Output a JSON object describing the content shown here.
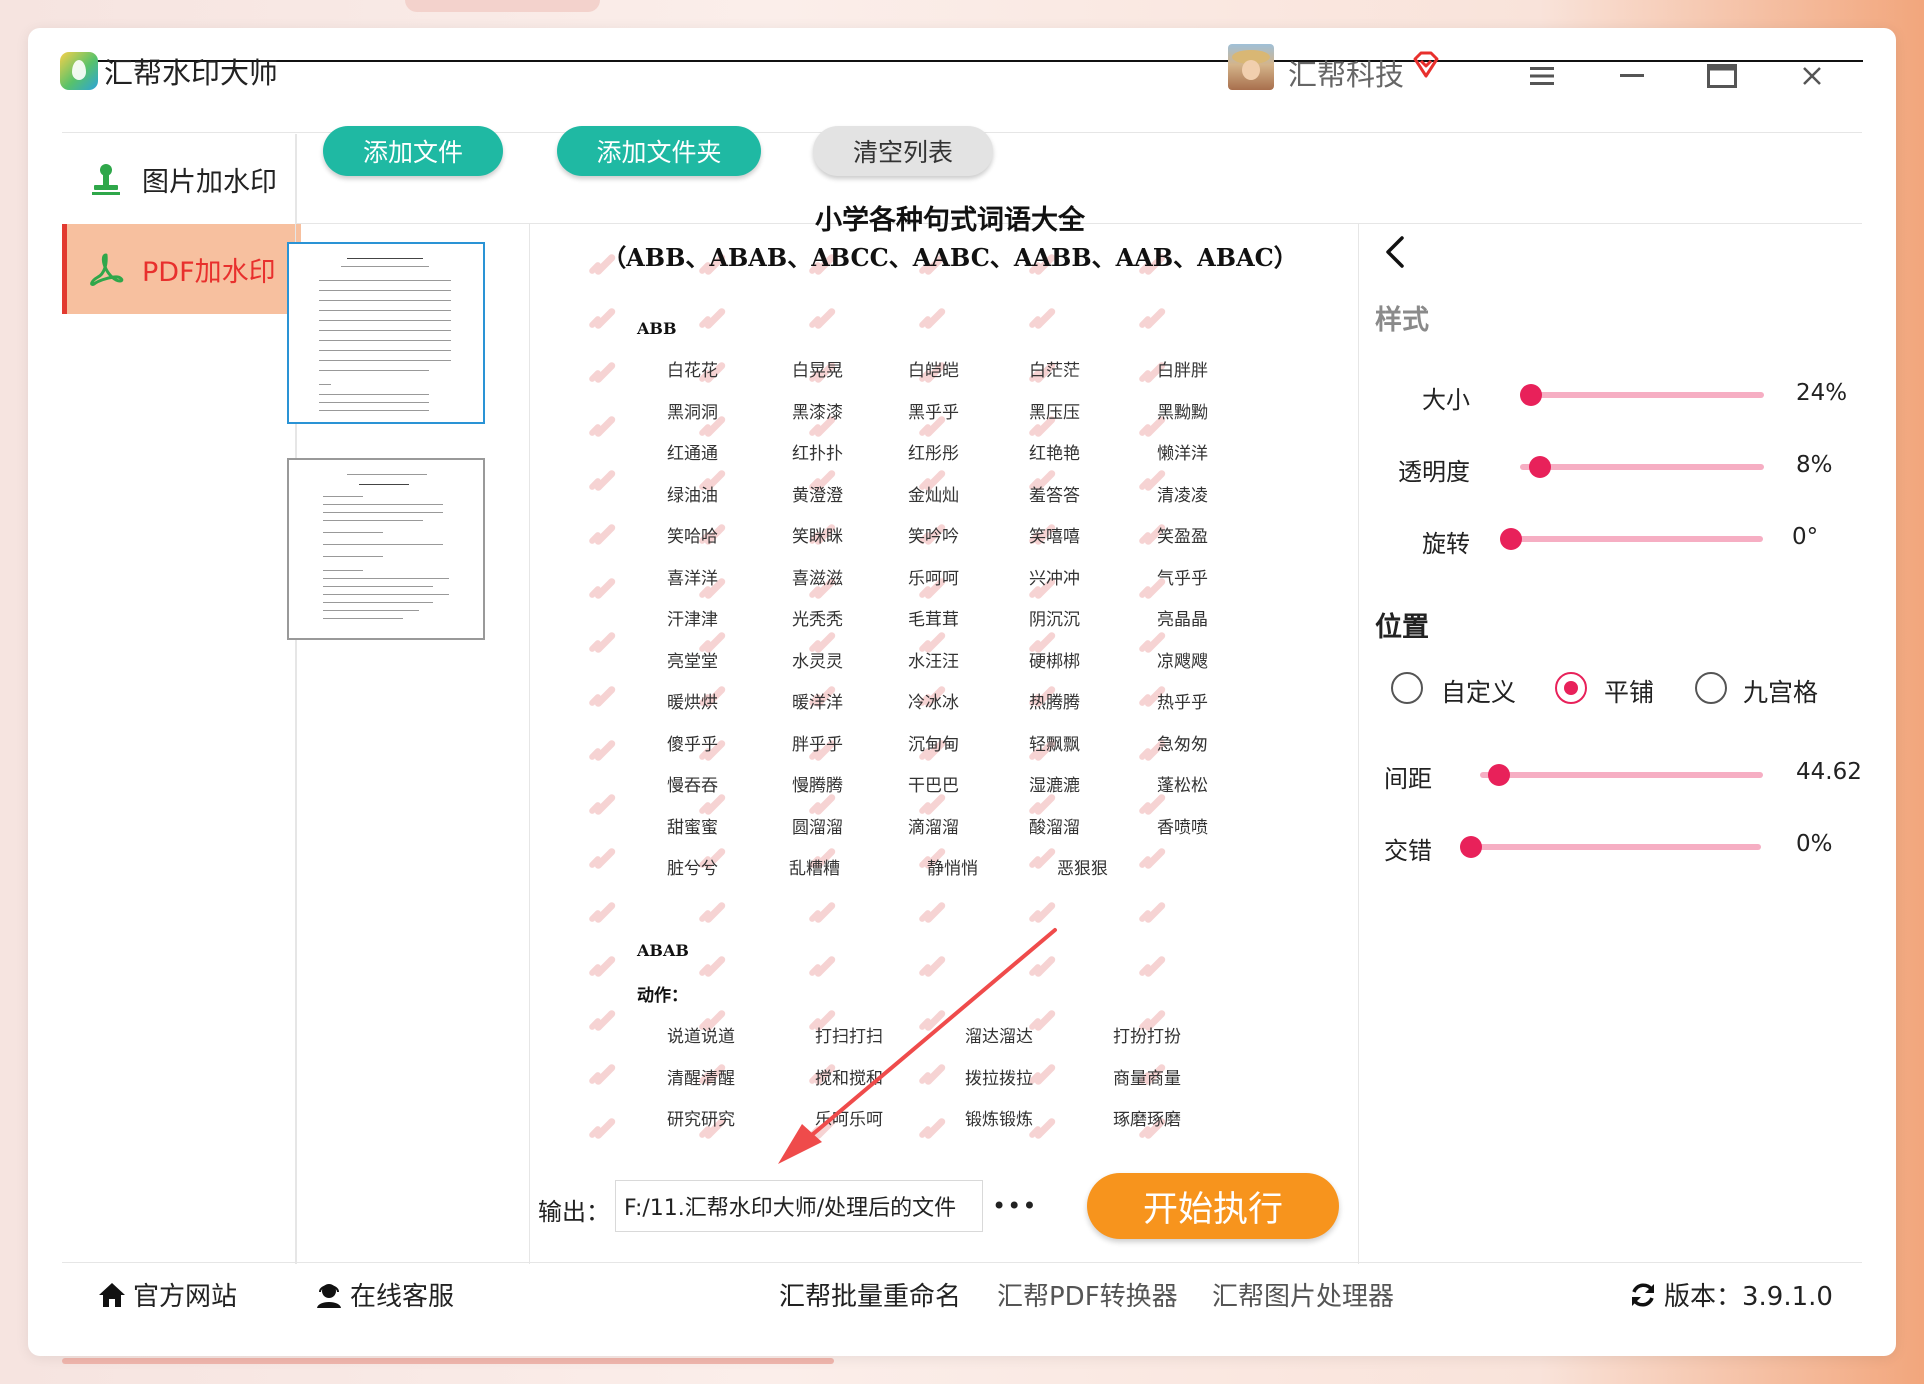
{
  "app": {
    "title": "汇帮水印大师"
  },
  "user": {
    "name": "汇帮科技"
  },
  "sidebar": {
    "items": [
      {
        "label": "图片加水印"
      },
      {
        "label": "PDF加水印"
      }
    ]
  },
  "toolbar": {
    "add_file": "添加文件",
    "add_folder": "添加文件夹",
    "clear_list": "清空列表"
  },
  "preview": {
    "title": "小学各种句式词语大全",
    "subtitle": "（ABB、ABAB、ABCC、AABC、AABB、AAB、ABAC）",
    "sections": [
      {
        "label": "ABB",
        "rows": [
          [
            "白花花",
            "白晃晃",
            "白皑皑",
            "白茫茫",
            "白胖胖"
          ],
          [
            "黑洞洞",
            "黑漆漆",
            "黑乎乎",
            "黑压压",
            "黑黝黝"
          ],
          [
            "红通通",
            "红扑扑",
            "红彤彤",
            "红艳艳",
            "懒洋洋"
          ],
          [
            "绿油油",
            "黄澄澄",
            "金灿灿",
            "羞答答",
            "清凌凌"
          ],
          [
            "笑哈哈",
            "笑眯眯",
            "笑吟吟",
            "笑嘻嘻",
            "笑盈盈"
          ],
          [
            "喜洋洋",
            "喜滋滋",
            "乐呵呵",
            "兴冲冲",
            "气乎乎"
          ],
          [
            "汗津津",
            "光秃秃",
            "毛茸茸",
            "阴沉沉",
            "亮晶晶"
          ],
          [
            "亮堂堂",
            "水灵灵",
            "水汪汪",
            "硬梆梆",
            "凉飕飕"
          ],
          [
            "暖烘烘",
            "暖洋洋",
            "冷冰冰",
            "热腾腾",
            "热乎乎"
          ],
          [
            "傻乎乎",
            "胖乎乎",
            "沉甸甸",
            "轻飘飘",
            "急匆匆"
          ],
          [
            "慢吞吞",
            "慢腾腾",
            "干巴巴",
            "湿漉漉",
            "蓬松松"
          ],
          [
            "甜蜜蜜",
            "圆溜溜",
            "滴溜溜",
            "酸溜溜",
            "香喷喷"
          ],
          [
            "脏兮兮",
            "乱糟糟",
            "静悄悄",
            "恶狠狠"
          ]
        ]
      },
      {
        "label": "ABAB",
        "sublabel": "动作：",
        "rows": [
          [
            "说道说道",
            "打扫打扫",
            "溜达溜达",
            "打扮打扮"
          ],
          [
            "清醒清醒",
            "搅和搅和",
            "拨拉拨拉",
            "商量商量"
          ],
          [
            "研究研究",
            "乐呵乐呵",
            "锻炼锻炼",
            "琢磨琢磨"
          ]
        ]
      }
    ]
  },
  "output": {
    "label": "输出：",
    "path": "F:/11.汇帮水印大师/处理后的文件",
    "more": "•••"
  },
  "start_button": "开始执行",
  "style_panel": {
    "heading": "样式",
    "sliders": [
      {
        "label": "大小",
        "value": "24%",
        "fraction": 0.0
      },
      {
        "label": "透明度",
        "value": "8%",
        "fraction": 0.02
      },
      {
        "label": "旋转",
        "value": "0°",
        "fraction": 0.0
      }
    ]
  },
  "position_panel": {
    "heading": "位置",
    "options": [
      {
        "label": "自定义",
        "selected": false
      },
      {
        "label": "平铺",
        "selected": true
      },
      {
        "label": "九宫格",
        "selected": false
      }
    ],
    "sliders": [
      {
        "label": "间距",
        "value": "44.625",
        "fraction": 0.03
      },
      {
        "label": "交错",
        "value": "0%",
        "fraction": 0.0
      }
    ]
  },
  "footer": {
    "website": "官方网站",
    "support": "在线客服",
    "links": [
      "汇帮批量重命名",
      "汇帮PDF转换器",
      "汇帮图片处理器"
    ],
    "version": "版本：3.9.1.0"
  },
  "colors": {
    "accent_teal": "#1fb9a3",
    "accent_orange": "#f7941d",
    "active_nav_bg": "#f7c09f",
    "active_nav_text": "#e8302d",
    "slider_pink": "#e8215a"
  }
}
